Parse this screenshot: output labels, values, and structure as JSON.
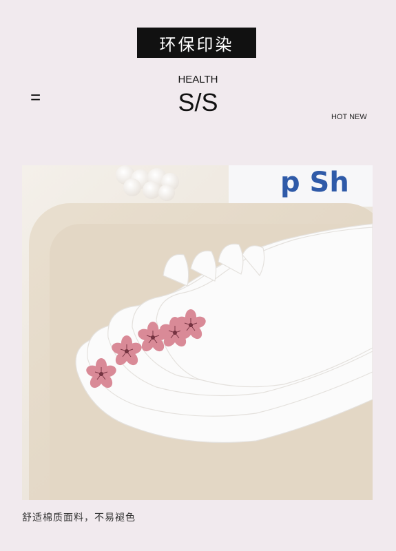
{
  "banner": {
    "text": "环保印染"
  },
  "symbol": "=",
  "heading": {
    "small": "HEALTH",
    "large": "S/S"
  },
  "tag": "HOT NEW",
  "photo": {
    "box_text": "p Sh",
    "subject": "white-socks-with-pink-sakura-embroidery"
  },
  "caption": "舒适棉质面料，不易褪色",
  "colors": {
    "background": "#f1eaee",
    "banner": "#111111",
    "sakura": "#d98a97",
    "box_text": "#2f5aa8"
  }
}
